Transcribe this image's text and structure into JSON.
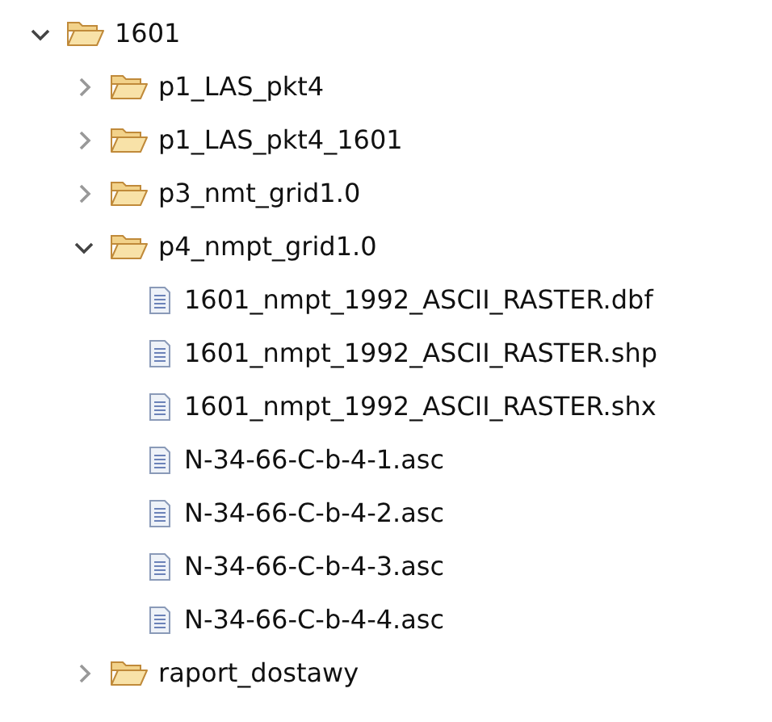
{
  "tree": [
    {
      "label": "1601",
      "kind": "folder",
      "expanded": true,
      "children": [
        {
          "label": "p1_LAS_pkt4",
          "kind": "folder",
          "expanded": false
        },
        {
          "label": "p1_LAS_pkt4_1601",
          "kind": "folder",
          "expanded": false
        },
        {
          "label": "p3_nmt_grid1.0",
          "kind": "folder",
          "expanded": false
        },
        {
          "label": "p4_nmpt_grid1.0",
          "kind": "folder",
          "expanded": true,
          "children": [
            {
              "label": "1601_nmpt_1992_ASCII_RASTER.dbf",
              "kind": "file"
            },
            {
              "label": "1601_nmpt_1992_ASCII_RASTER.shp",
              "kind": "file"
            },
            {
              "label": "1601_nmpt_1992_ASCII_RASTER.shx",
              "kind": "file"
            },
            {
              "label": "N-34-66-C-b-4-1.asc",
              "kind": "file"
            },
            {
              "label": "N-34-66-C-b-4-2.asc",
              "kind": "file"
            },
            {
              "label": "N-34-66-C-b-4-3.asc",
              "kind": "file"
            },
            {
              "label": "N-34-66-C-b-4-4.asc",
              "kind": "file"
            }
          ]
        },
        {
          "label": "raport_dostawy",
          "kind": "folder",
          "expanded": false
        }
      ]
    }
  ]
}
